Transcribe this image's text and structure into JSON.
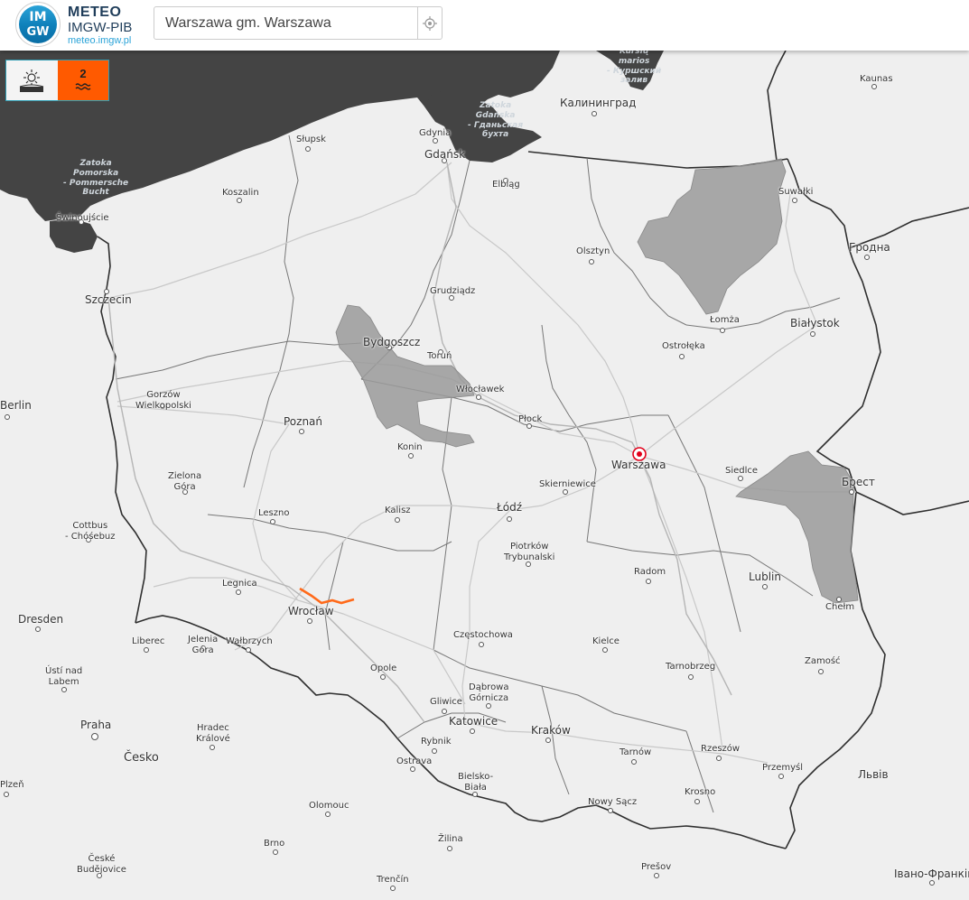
{
  "header": {
    "logo_badge_top": "IM",
    "logo_badge_bottom": "GW",
    "brand": "METEO",
    "org": "IMGW-PIB",
    "url": "meteo.imgw.pl"
  },
  "search": {
    "value": "Warszawa gm. Warszawa",
    "locate_icon": "crosshair-icon"
  },
  "layers": {
    "sun_icon": "sun-over-ground-icon",
    "water_level_warning": "2",
    "water_icon": "waves-icon",
    "water_color": "#ff5a00"
  },
  "colors": {
    "sea": "#444444",
    "land": "#efefef",
    "warning_area": "#9a9a9a",
    "river_warning": "#ff6a1a",
    "marker": "#e2001a"
  },
  "map": {
    "seas": [
      "Zatoka\nPomorska\n- Pommersche\nBucht",
      "Zatoka\nGdańska\n- Гданьская\nбухта",
      "Kuršių\nmarios\n- Куршский\nзалив"
    ],
    "cities": [
      "Słupsk",
      "Gdynia",
      "Gdańsk",
      "Elbląg",
      "Калининград",
      "Koszalin",
      "Świnoujście",
      "Szczecin",
      "Suwałki",
      "Kaunas",
      "Olsztyn",
      "Grudziądz",
      "Bydgoszcz",
      "Toruń",
      "Łomża",
      "Białystok",
      "Гродна",
      "Ostrołęka",
      "Włocławek",
      "Berlin",
      "Gorzów\nWielkopolski",
      "Poznań",
      "Płock",
      "Konin",
      "Warszawa",
      "Siedlce",
      "Брест",
      "Zielona\nGóra",
      "Skierniewice",
      "Łódź",
      "Cottbus\n- Chóśebuz",
      "Leszno",
      "Kalisz",
      "Piotrków\nTrybunalski",
      "Radom",
      "Lublin",
      "Legnica",
      "Chełm",
      "Wrocław",
      "Dresden",
      "Liberec",
      "Jelenia\nGóra",
      "Wałbrzych",
      "Częstochowa",
      "Kielce",
      "Zamość",
      "Ústí nad\nLabem",
      "Opole",
      "Tarnobrzeg",
      "Dąbrowa\nGórnicza",
      "Gliwice",
      "Praha",
      "Katowice",
      "Kraków",
      "Hradec\nKrálové",
      "Rybnik",
      "Tarnów",
      "Rzeszów",
      "Česko",
      "Ostrava",
      "Przemyśl",
      "Bielsko-\nBiała",
      "Львів",
      "Plzeň",
      "Krosno",
      "Nowy Sącz",
      "Olomouc",
      "Brno",
      "Žilina",
      "České\nBudějovice",
      "Trenčín",
      "Prešov",
      "Івано-Франків"
    ]
  }
}
